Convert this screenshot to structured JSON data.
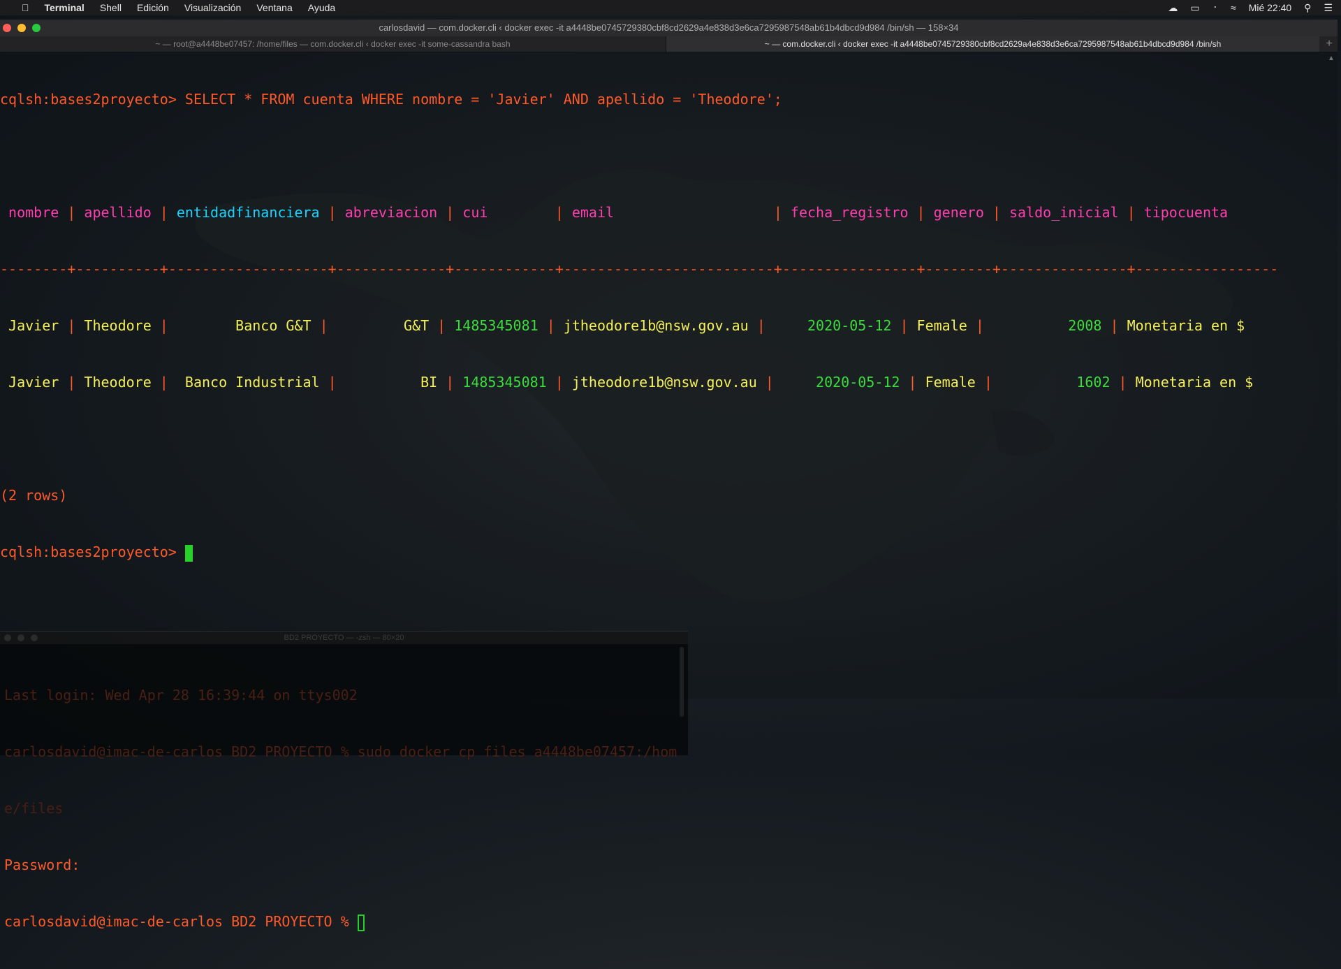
{
  "menubar": {
    "app": "Terminal",
    "items": [
      "Shell",
      "Edición",
      "Visualización",
      "Ventana",
      "Ayuda"
    ],
    "clock": "Mié 22:40"
  },
  "window": {
    "title": "carlosdavid — com.docker.cli ‹ docker exec -it a4448be0745729380cbf8cd2629a4e838d3e6ca7295987548ab61b4dbcd9d984 /bin/sh — 158×34",
    "tabs": [
      "~ — root@a4448be07457: /home/files — com.docker.cli ‹ docker exec -it some-cassandra bash",
      "~ — com.docker.cli ‹ docker exec -it a4448be0745729380cbf8cd2629a4e838d3e6ca7295987548ab61b4dbcd9d984 /bin/sh"
    ],
    "new_tab": "+"
  },
  "terminal": {
    "prompt": "cqlsh:bases2proyecto>",
    "query": " SELECT * FROM cuenta WHERE nombre = 'Javier' AND apellido = 'Theodore';",
    "columns": [
      "nombre",
      "apellido",
      "entidadfinanciera",
      "abreviacion",
      "cui",
      "email",
      "fecha_registro",
      "genero",
      "saldo_inicial",
      "tipocuenta"
    ],
    "separator": "--------+----------+-------------------+-------------+------------+-------------------------+----------------+--------+---------------+-----------------",
    "rows": [
      [
        "Javier",
        "Theodore",
        "Banco G&T",
        "G&T",
        "1485345081",
        "jtheodore1b@nsw.gov.au",
        "2020-05-12",
        "Female",
        "2008",
        "Monetaria en $"
      ],
      [
        "Javier",
        "Theodore",
        "Banco Industrial",
        "BI",
        "1485345081",
        "jtheodore1b@nsw.gov.au",
        "2020-05-12",
        "Female",
        "1602",
        "Monetaria en $"
      ]
    ],
    "row_count": "(2 rows)",
    "final_prompt": "cqlsh:bases2proyecto>"
  },
  "terminal2": {
    "title": "BD2 PROYECTO — -zsh — 80×20",
    "lines": [
      "Last login: Wed Apr 28 16:39:44 on ttys002",
      "carlosdavid@imac-de-carlos BD2 PROYECTO % sudo docker cp files a4448be07457:/hom",
      "e/files",
      "Password:",
      "carlosdavid@imac-de-carlos BD2 PROYECTO % "
    ]
  },
  "colors": {
    "prompt": "#ff5a2a",
    "header": "#ff3fb0",
    "header_key": "#1fd3ff",
    "text_value": "#f5f05a",
    "number_value": "#3ddc3d",
    "cursor": "#27d12a"
  }
}
